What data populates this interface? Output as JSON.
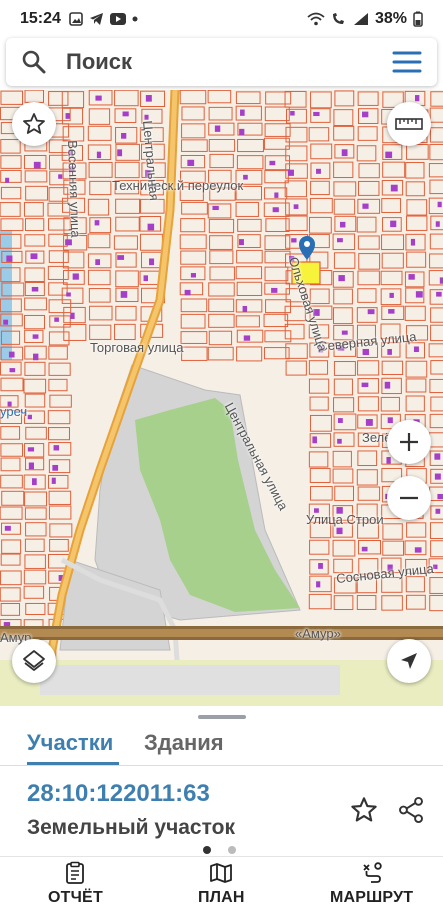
{
  "status_bar": {
    "time": "15:24",
    "battery": "38%",
    "notification_icons": [
      "gallery-icon",
      "telegram-icon",
      "youtube-icon",
      "dot-icon"
    ],
    "system_icons": [
      "wifi-icon",
      "wifi-call-icon",
      "signal-icon",
      "battery-icon"
    ]
  },
  "search": {
    "placeholder": "Поиск"
  },
  "map": {
    "street_labels": {
      "tekhnichesky_lane": "Техническ.й переулок",
      "torgovaya": "Торговая улица",
      "severnaya": "Северная улица",
      "tsentralnaya_top": "Центральная",
      "tsentralnaya_mid": "Центральная улица",
      "vesennyaya": "Весенняя улица",
      "olkhovaya": "Ольховая улица",
      "zelenaya": "Зелёная",
      "stroiteley": "Улица Строи",
      "sosnovaya": "Сосновая улица",
      "amur_road": "«Амур»",
      "left_edge": "Амур",
      "left_edge_street": "уреч"
    },
    "colors": {
      "background": "#f5efe6",
      "parcel_border": "#e0603a",
      "building": "#a63fc7",
      "road_main": "#e8a23a",
      "forest": "#a8d08d",
      "industrial": "#cfcfcf",
      "highway": "#8a6a3c",
      "water": "#9ccbe8",
      "selected_parcel": "#f7f23a",
      "pin": "#2a6fb5"
    }
  },
  "map_controls": {
    "favorite_icon": "star-icon",
    "ruler_icon": "ruler-icon",
    "zoom_in_icon": "plus-icon",
    "zoom_out_icon": "minus-icon",
    "layers_icon": "layers-icon",
    "locate_icon": "navigation-arrow-icon"
  },
  "sheet": {
    "tabs": [
      {
        "label": "Участки",
        "active": true
      },
      {
        "label": "Здания",
        "active": false
      }
    ],
    "parcel": {
      "cadastral_number": "28:10:122011:63",
      "type": "Земельный участок"
    },
    "page_indicator": {
      "count": 2,
      "current": 1
    }
  },
  "bottom_nav": {
    "items": [
      {
        "label": "ОТЧЁТ",
        "icon": "report-icon"
      },
      {
        "label": "ПЛАН",
        "icon": "map-icon"
      },
      {
        "label": "МАРШРУТ",
        "icon": "route-icon"
      }
    ]
  }
}
